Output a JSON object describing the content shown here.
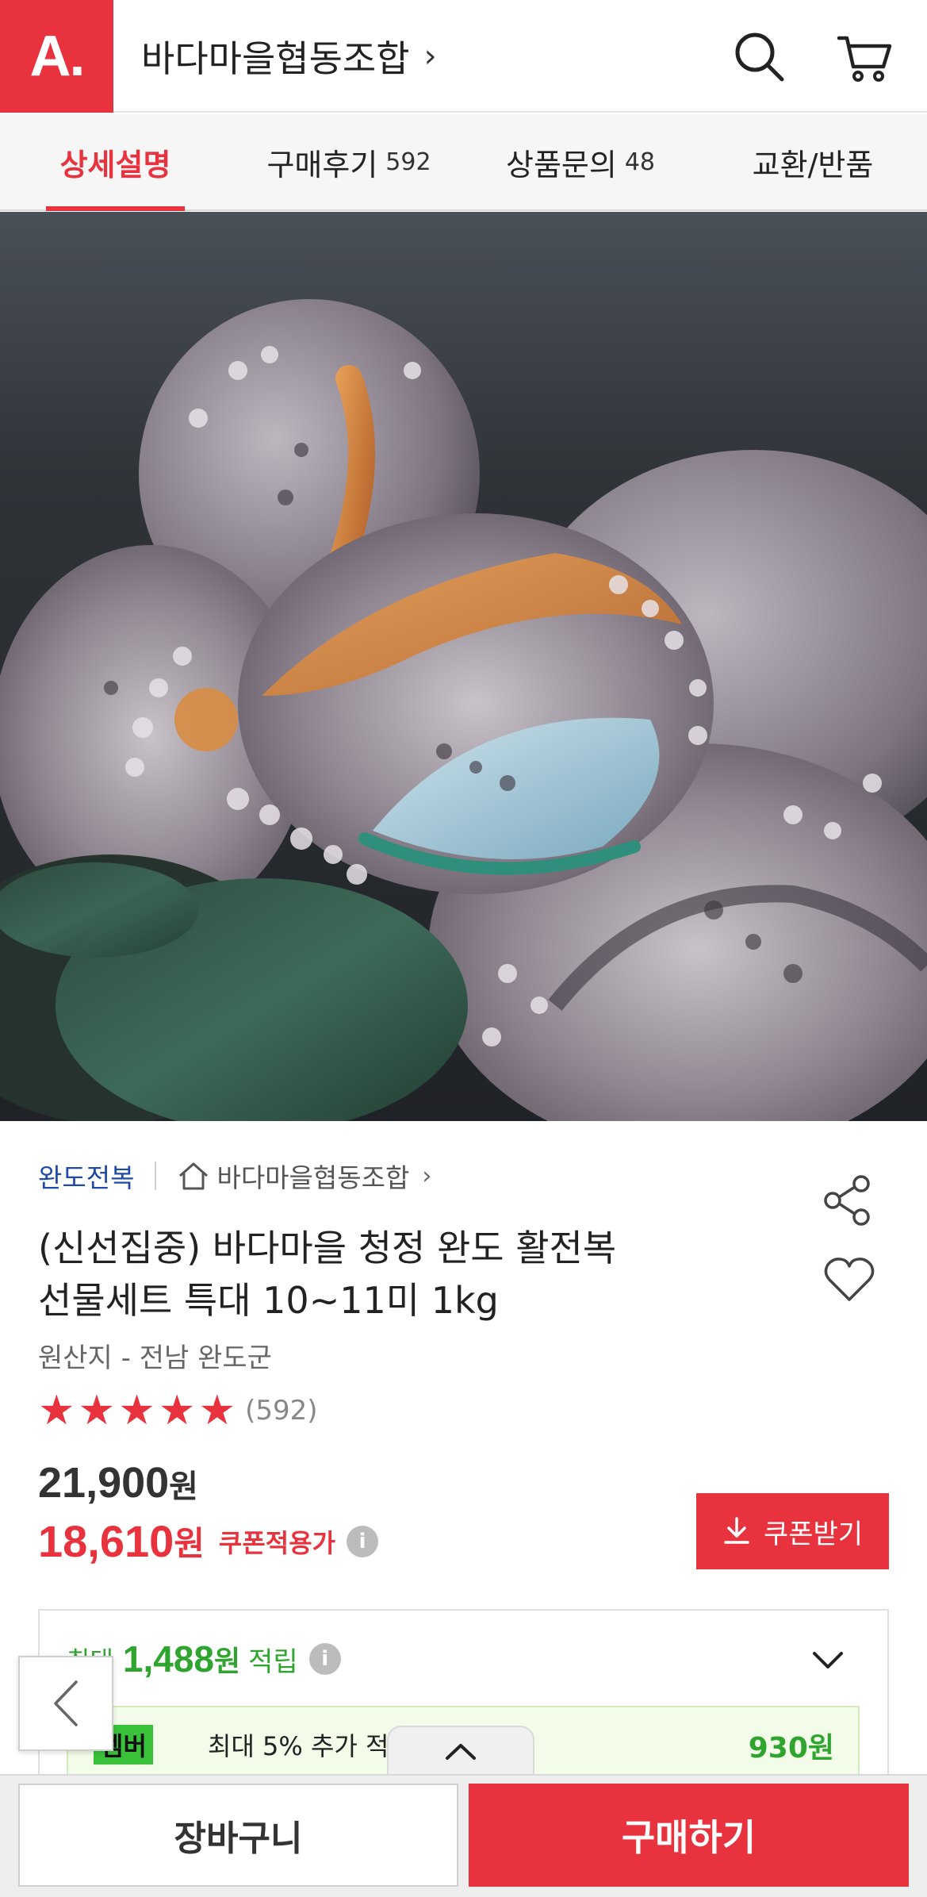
{
  "header": {
    "logo_text": "A.",
    "store_name": "바다마을협동조합",
    "chevron": "›",
    "icons": [
      "search-icon",
      "cart-icon"
    ],
    "brand_color": "#e8333f"
  },
  "tabs": [
    {
      "label": "상세설명",
      "count": ""
    },
    {
      "label": "구매후기",
      "count": "592"
    },
    {
      "label": "상품문의",
      "count": "48"
    },
    {
      "label": "교환/반품",
      "count": ""
    }
  ],
  "product": {
    "category": "완도전복",
    "seller": "바다마을협동조합",
    "title_line1": "(신선집중) 바다마을 청정 완도 활전복",
    "title_line2": "선물세트 특대 10~11미 1kg",
    "origin": "원산지 - 전남 완도군",
    "rating": 5,
    "review_count": "(592)",
    "price_original": "21,900",
    "price_sale": "18,610",
    "currency": "원",
    "sale_label": "쿠폰적용가",
    "info_icon": "i",
    "coupon_button": "쿠폰받기"
  },
  "points": {
    "prefix": "최대",
    "value": "1,488",
    "currency": "원",
    "suffix": "적립",
    "member_badge": "멤버",
    "member_text": "최대 5% 추가 적",
    "member_value": "930원"
  },
  "bottom": {
    "cart_label": "장바구니",
    "buy_label": "구매하기"
  }
}
